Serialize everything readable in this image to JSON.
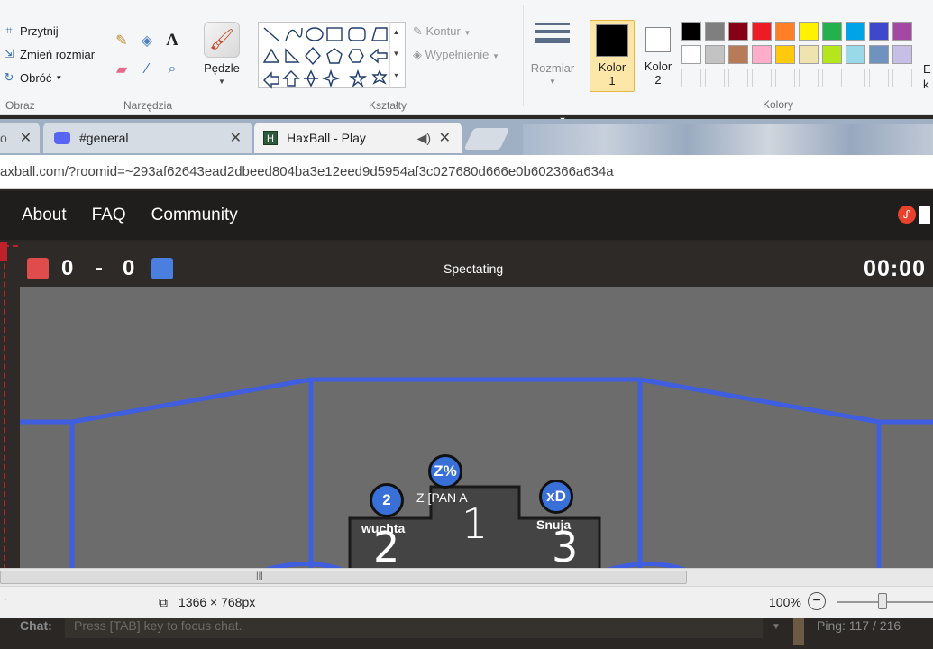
{
  "paint": {
    "image_group": {
      "crop": "Przytnij",
      "resize": "Zmień rozmiar",
      "rotate": "Obróć",
      "label": "Obraz"
    },
    "tools_group": {
      "label": "Narzędzia"
    },
    "brushes": {
      "label": "Pędzle"
    },
    "shapes_group": {
      "outline": "Kontur",
      "fill": "Wypełnienie",
      "label": "Kształty"
    },
    "size": {
      "label": "Rozmiar"
    },
    "color1": {
      "label": "Kolor",
      "num": "1",
      "value": "#000000"
    },
    "color2": {
      "label": "Kolor",
      "num": "2",
      "value": "#ffffff"
    },
    "colors_label": "Kolory",
    "edit_label_partial": "E",
    "edit_label_partial2": "k",
    "palette_row1": [
      "#000000",
      "#7f7f7f",
      "#880015",
      "#ed1c24",
      "#ff7f27",
      "#fff200",
      "#22b14c",
      "#00a2e8",
      "#3f48cc",
      "#a349a4"
    ],
    "palette_row2": [
      "#ffffff",
      "#c3c3c3",
      "#b97a57",
      "#ffaec9",
      "#ffc90e",
      "#efe4b0",
      "#b5e61d",
      "#99d9ea",
      "#7092be",
      "#c8bfe7"
    ],
    "palette_row3": [
      "#f5f6f7",
      "#f5f6f7",
      "#f5f6f7",
      "#f5f6f7",
      "#f5f6f7",
      "#f5f6f7",
      "#f5f6f7",
      "#f5f6f7",
      "#f5f6f7",
      "#f5f6f7"
    ]
  },
  "browser": {
    "tabs": [
      {
        "label": "o",
        "icon": "page-icon"
      },
      {
        "label": "#general",
        "icon": "discord-icon"
      },
      {
        "label": "HaxBall - Play",
        "icon": "haxball-icon"
      }
    ],
    "url": "axball.com/?roomid=~293af62643ead2dbeed804ba3e12eed9d5954af3c027680d666e0b602366a634a"
  },
  "site_nav": {
    "about": "About",
    "faq": "FAQ",
    "community": "Community"
  },
  "game": {
    "red_score": "0",
    "dash": "-",
    "blue_score": "0",
    "status": "Spectating",
    "timer": "00:00",
    "red_color": "#e04b4b",
    "blue_color": "#4a7fe0",
    "players": [
      {
        "avatar": "Z%",
        "name": "Z [PAN A",
        "place": "1"
      },
      {
        "avatar": "2",
        "name": "wuchta",
        "place": "2"
      },
      {
        "avatar": "xD",
        "name": "Snuja",
        "place": "3"
      }
    ]
  },
  "statusbar": {
    "dimensions": "1366 × 768px",
    "zoom": "100%"
  },
  "chat": {
    "label": "Chat:",
    "placeholder": "Press [TAB] key to focus chat.",
    "ping": "Ping: 117 / 216"
  }
}
